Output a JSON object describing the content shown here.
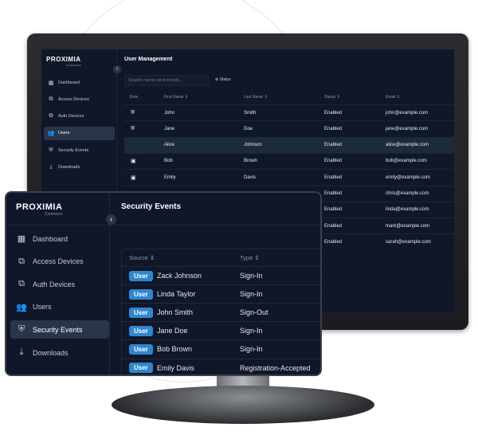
{
  "brand": {
    "name": "PROXIMIA",
    "sub": "Connect"
  },
  "monitor": {
    "title": "User Management",
    "search_placeholder": "Search names and emails...",
    "status_filter": "Status",
    "sidebar": [
      {
        "label": "Dashboard",
        "icon": "dashboard-icon"
      },
      {
        "label": "Access Devices",
        "icon": "devices-icon"
      },
      {
        "label": "Auth Devices",
        "icon": "devices-icon"
      },
      {
        "label": "Users",
        "icon": "users-icon",
        "active": true
      },
      {
        "label": "Security Events",
        "icon": "shield-icon"
      },
      {
        "label": "Downloads",
        "icon": "download-icon"
      }
    ],
    "columns": [
      "Role",
      "First Name",
      "Last Name",
      "Status",
      "Email"
    ],
    "rows": [
      {
        "role": "shield",
        "first": "John",
        "last": "Smith",
        "status": "Enabled",
        "email": "john@example.com"
      },
      {
        "role": "shield",
        "first": "Jane",
        "last": "Doe",
        "status": "Enabled",
        "email": "jane@example.com"
      },
      {
        "role": "",
        "first": "Alice",
        "last": "Johnson",
        "status": "Enabled",
        "email": "alice@example.com",
        "selected": true
      },
      {
        "role": "badge",
        "first": "Bob",
        "last": "Brown",
        "status": "Enabled",
        "email": "bob@example.com"
      },
      {
        "role": "badge",
        "first": "Emily",
        "last": "Davis",
        "status": "Enabled",
        "email": "emily@example.com"
      },
      {
        "status": "Enabled",
        "email": "chris@example.com"
      },
      {
        "status": "Enabled",
        "email": "linda@example.com"
      },
      {
        "status": "Enabled",
        "email": "mark@example.com"
      },
      {
        "status": "Enabled",
        "email": "sarah@example.com"
      }
    ]
  },
  "panel": {
    "title": "Security Events",
    "sidebar": [
      {
        "label": "Dashboard"
      },
      {
        "label": "Access Devices"
      },
      {
        "label": "Auth Devices"
      },
      {
        "label": "Users"
      },
      {
        "label": "Security Events",
        "active": true
      },
      {
        "label": "Downloads"
      }
    ],
    "columns": [
      "Source",
      "Type"
    ],
    "rows": [
      {
        "badge": "User",
        "name": "Zack Johnson",
        "type": "Sign-In"
      },
      {
        "badge": "User",
        "name": "Linda Taylor",
        "type": "Sign-In"
      },
      {
        "badge": "User",
        "name": "John Smith",
        "type": "Sign-Out"
      },
      {
        "badge": "User",
        "name": "Jane Doe",
        "type": "Sign-In"
      },
      {
        "badge": "User",
        "name": "Bob Brown",
        "type": "Sign-In"
      },
      {
        "badge": "User",
        "name": "Emily Davis",
        "type": "Registration-Accepted"
      }
    ]
  },
  "colors": {
    "accent": "#2f86d1",
    "background": "#0f1728",
    "active": "#2a3549"
  }
}
